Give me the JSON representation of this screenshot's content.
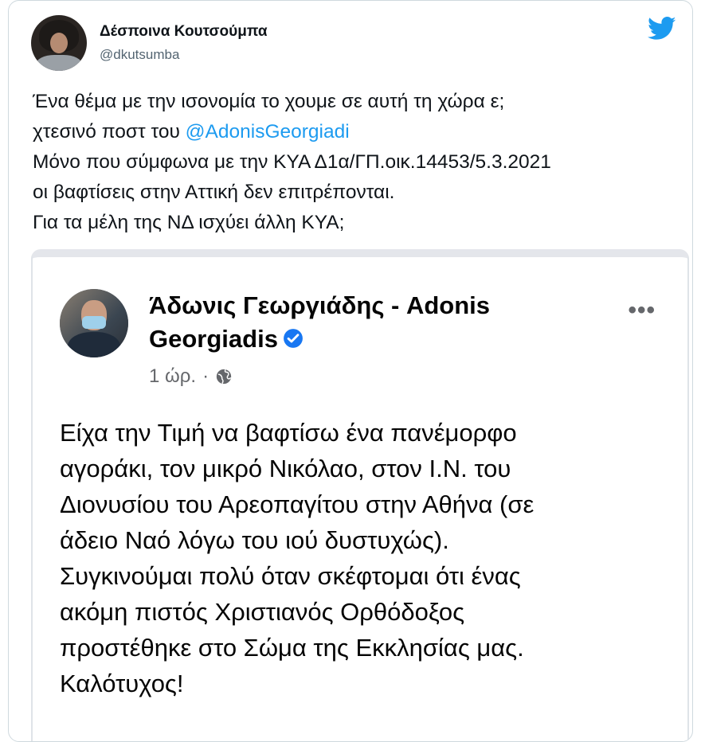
{
  "tweet": {
    "author": {
      "display_name": "Δέσποινα Κουτσούμπα",
      "handle": "@dkutsumba",
      "avatar_icon": "user-avatar"
    },
    "brand_icon": "twitter-bird-icon",
    "brand_color": "#1d9bf0",
    "text_lines": {
      "l1": "Ένα θέμα με την ισονομία το χουμε σε αυτή τη χώρα ε;",
      "l2_prefix": "χτεσινό ποστ του ",
      "l2_mention": "@AdonisGeorgiadi",
      "l3": "Μόνο που σύμφωνα με την ΚΥΑ Δ1α/ΓΠ.οικ.14453/5.3.2021",
      "l4": "οι βαφτίσεις στην Αττική δεν επιτρέπονται.",
      "l5": "Για τα μέλη της ΝΔ ισχύει άλλη ΚΥΑ;"
    }
  },
  "embedded_post": {
    "author_line1": "Άδωνις Γεωργιάδης - Adonis",
    "author_line2": "Georgiadis",
    "verified_icon": "verified-badge-icon",
    "more_label": "•••",
    "time": "1 ώρ.",
    "separator": "·",
    "audience_icon": "globe-icon",
    "body_lines": {
      "l1": "Είχα την Τιμή να βαφτίσω ένα πανέμορφο",
      "l2": "αγοράκι, τον μικρό Νικόλαο, στον Ι.Ν. του",
      "l3": "Διονυσίου του Αρεοπαγίτου στην Αθήνα (σε",
      "l4": "άδειο Ναό λόγω του ιού δυστυχώς).",
      "l5": "Συγκινούμαι πολύ όταν σκέφτομαι ότι ένας",
      "l6": "ακόμη πιστός Χριστιανός Ορθόδοξος",
      "l7": "προστέθηκε στο Σώμα της Εκκλησίας μας.",
      "l8": "Καλότυχος!"
    }
  }
}
